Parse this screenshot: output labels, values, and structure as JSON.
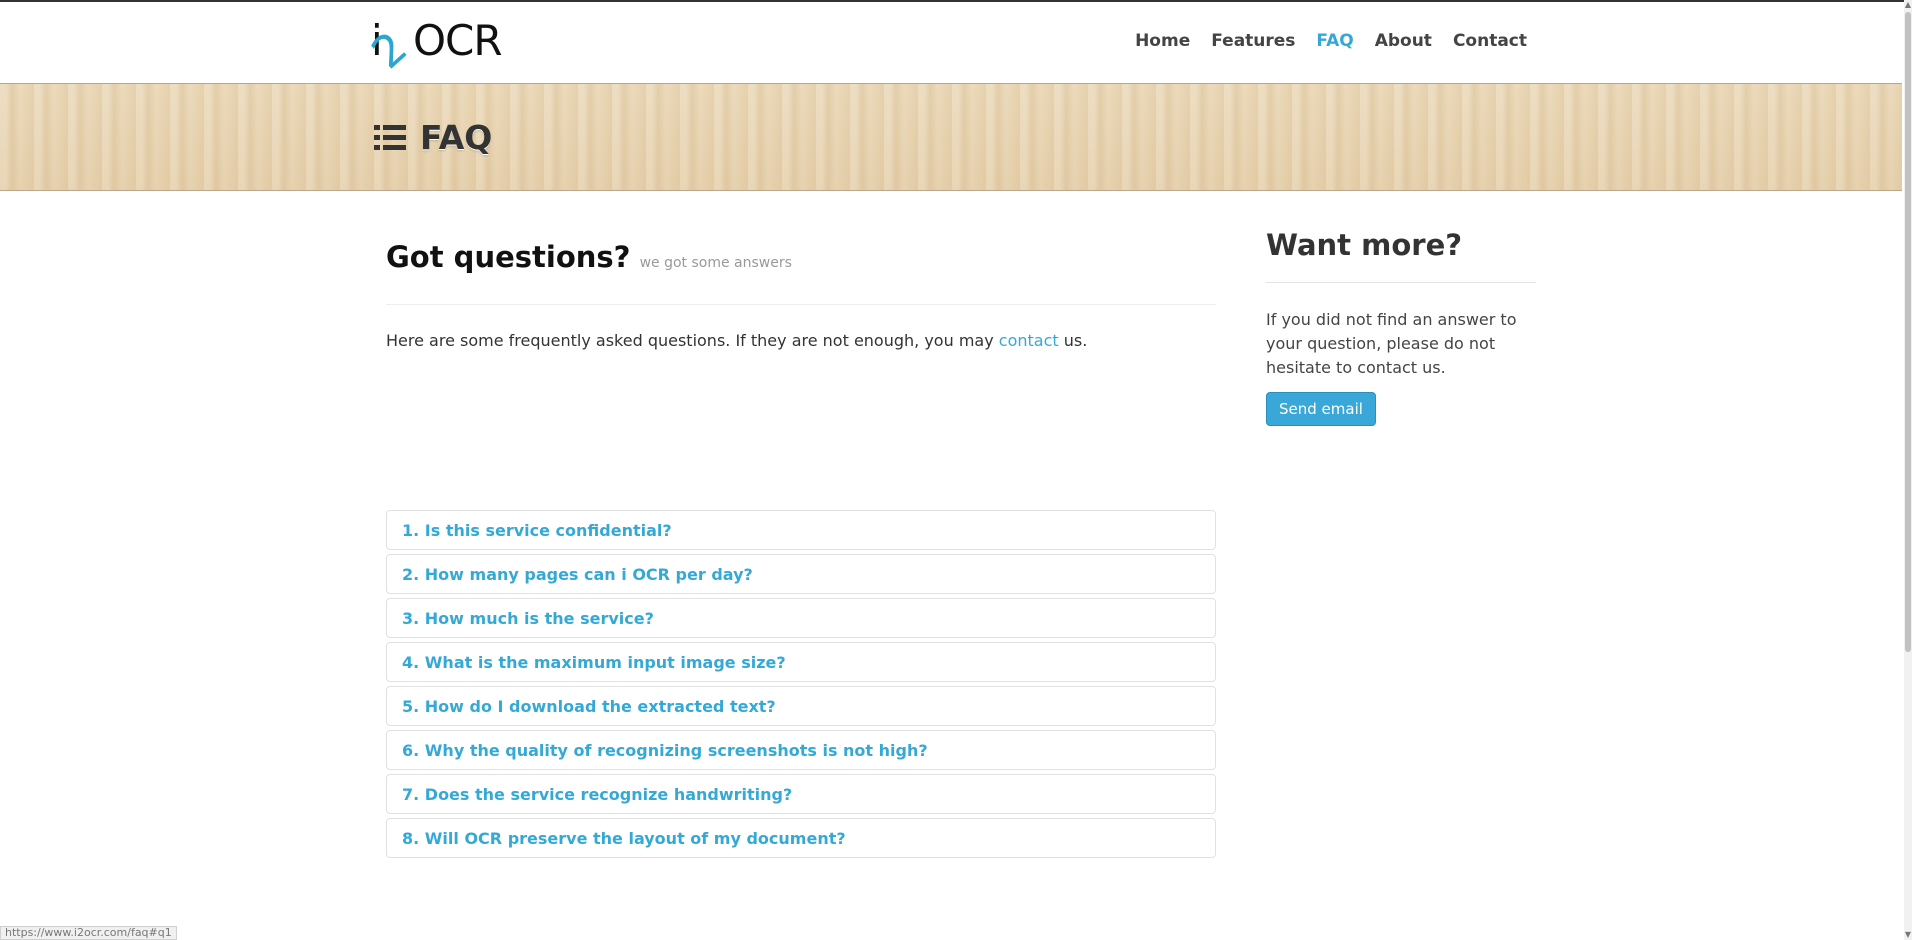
{
  "logo": {
    "i": "i",
    "two": "2",
    "ocr": "OCR"
  },
  "nav": [
    "Home",
    "Features",
    "FAQ",
    "About",
    "Contact"
  ],
  "banner": {
    "title": "FAQ"
  },
  "main": {
    "heading": "Got questions?",
    "subheading": "we got some answers",
    "intro_before": "Here are some frequently asked questions. If they are not enough, you may ",
    "intro_link": "contact",
    "intro_after": " us."
  },
  "faq": [
    "1. Is this service confidential?",
    "2. How many pages can i OCR per day?",
    "3. How much is the service?",
    "4. What is the maximum input image size?",
    "5. How do I download the extracted text?",
    "6. Why the quality of recognizing screenshots is not high?",
    "7. Does the service recognize handwriting?",
    "8. Will OCR preserve the layout of my document?"
  ],
  "sidebar": {
    "heading": "Want more?",
    "text": "If you did not find an answer to your question, please do not hesitate to contact us.",
    "button": "Send email"
  },
  "status": {
    "url": "https://www.i2ocr.com/faq#q1"
  },
  "colors": {
    "accent": "#35a9d6",
    "button": "#39a7d8"
  }
}
